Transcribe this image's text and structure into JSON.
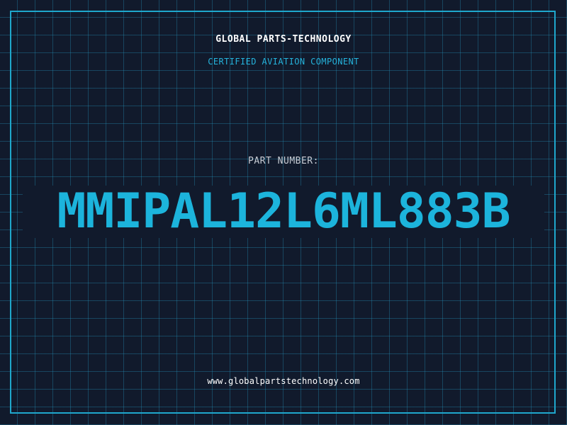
{
  "header": {
    "company_name": "GLOBAL PARTS-TECHNOLOGY",
    "tagline": "CERTIFIED AVIATION COMPONENT"
  },
  "part": {
    "label": "PART NUMBER:",
    "number": "MMIPAL12L6ML883B"
  },
  "footer": {
    "website": "www.globalpartstechnology.com"
  },
  "colors": {
    "background": "#111a2c",
    "grid": "#2696be",
    "accent": "#1cb4dc",
    "text": "#ffffff",
    "muted": "#c7ccd4"
  }
}
